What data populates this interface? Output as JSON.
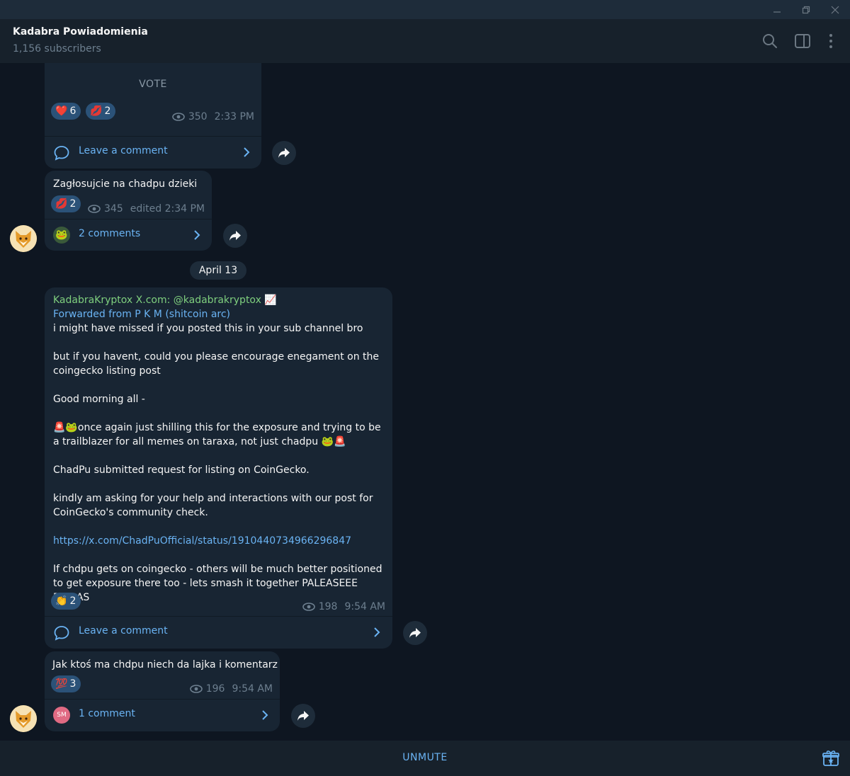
{
  "window": {
    "minimize_icon": "minimize-icon",
    "restore_icon": "restore-icon",
    "close_icon": "close-icon"
  },
  "header": {
    "title": "Kadabra Powiadomienia",
    "subtitle": "1,156 subscribers"
  },
  "messages": [
    {
      "vote_label": "VOTE",
      "reactions": [
        {
          "emoji": "❤️",
          "count": "6"
        },
        {
          "emoji": "💋",
          "count": "2"
        }
      ],
      "views": "350",
      "time": "2:33 PM",
      "comment_label": "Leave a comment"
    },
    {
      "text": "Zagłosujcie na chadpu dzieki",
      "reactions": [
        {
          "emoji": "💋",
          "count": "2"
        }
      ],
      "views": "345",
      "time": "edited 2:34 PM",
      "comment_label": "2 comments"
    },
    {
      "date": "April 13"
    },
    {
      "source": "KadabraKryptox X.com: @kadabrakryptox 📈",
      "forwarded": "Forwarded from P K M (shitcoin arc)",
      "line1": "i might have missed if you posted this in your sub channel bro",
      "line2": "but if you havent, could you please encourage enegament on the\ncoingecko listing post",
      "line3": "Good morning all -",
      "line4a_emoji": "🚨🐸",
      "line4": "once again just shilling this for the exposure and trying to be\na trailblazer for all memes on taraxa, not just chadpu ",
      "line4b_emoji": "🐸🚨",
      "line5": "ChadPu submitted request for listing on CoinGecko.",
      "line6": "kindly am asking for your help and interactions with our post for\nCoinGecko's community check.",
      "link": "https://x.com/ChadPuOfficial/status/1910440734966296847",
      "line7": "If chdpu gets on coingecko - others will be much better positioned\nto get exposure there too - lets smash it together PALEASEEE FELLAS",
      "reactions": [
        {
          "emoji": "👏",
          "count": "2"
        }
      ],
      "views": "198",
      "time": "9:54 AM",
      "comment_label": "Leave a comment"
    },
    {
      "text": "Jak ktoś ma chdpu niech da lajka i komentarz",
      "reactions": [
        {
          "emoji": "💯",
          "count": "3"
        }
      ],
      "views": "196",
      "time": "9:54 AM",
      "commenter_initials": "SM",
      "comment_label": "1 comment"
    }
  ],
  "footer": {
    "unmute_label": "UNMUTE",
    "gift_icon": "gift-icon"
  },
  "colors": {
    "bg": "#0e1621",
    "bubble": "#182533",
    "accent": "#6ab3f3",
    "reaction": "#2b5278",
    "muted": "#6d7f8f"
  }
}
